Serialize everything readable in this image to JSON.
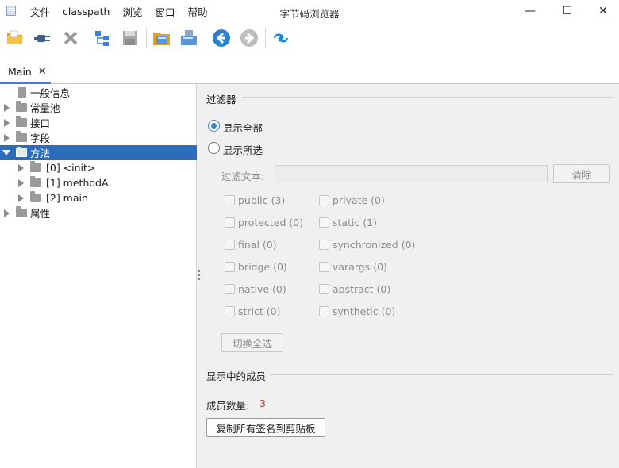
{
  "window": {
    "title": "字节码浏览器",
    "menu": [
      "文件",
      "classpath",
      "浏览",
      "窗口",
      "帮助"
    ],
    "controls": {
      "minimize": "—",
      "maximize": "☐",
      "close": "✕"
    }
  },
  "toolbar": {
    "icons": [
      "open-folder-icon",
      "plug-icon",
      "remove-icon",
      "hierarchy-icon",
      "save-icon",
      "open-archive-icon",
      "export-icon",
      "back-icon",
      "forward-icon",
      "refresh-icon"
    ]
  },
  "tabs": [
    {
      "label": "Main",
      "close": "✕"
    }
  ],
  "tree": {
    "nodes": [
      {
        "label": "一般信息"
      },
      {
        "label": "常量池"
      },
      {
        "label": "接口"
      },
      {
        "label": "字段"
      },
      {
        "label": "方法"
      },
      {
        "label": "[0] <init>"
      },
      {
        "label": "[1] methodA"
      },
      {
        "label": "[2] main"
      },
      {
        "label": "属性"
      }
    ]
  },
  "filter": {
    "section_title": "过滤器",
    "show_all": "显示全部",
    "show_selected": "显示所选",
    "filter_text_label": "过滤文本:",
    "filter_text_value": "",
    "clear_button": "清除",
    "checkboxes_left": [
      "public (3)",
      "protected (0)",
      "final (0)",
      "bridge (0)",
      "native (0)",
      "strict (0)"
    ],
    "checkboxes_right": [
      "private (0)",
      "static (1)",
      "synchronized (0)",
      "varargs (0)",
      "abstract (0)",
      "synthetic (0)"
    ],
    "toggle_button": "切换全选"
  },
  "members": {
    "section_title": "显示中的成员",
    "count_label": "成员数量:",
    "count_value": "3",
    "copy_button": "复制所有签名到剪贴板"
  }
}
